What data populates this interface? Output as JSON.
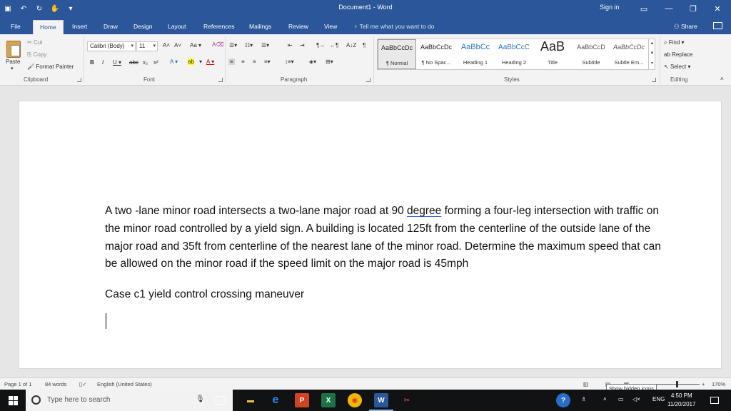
{
  "window": {
    "title": "Document1  -  Word",
    "signin": "Sign in"
  },
  "tabs": [
    "File",
    "Home",
    "Insert",
    "Draw",
    "Design",
    "Layout",
    "References",
    "Mailings",
    "Review",
    "View"
  ],
  "active_tab": "Home",
  "tellme": "Tell me what you want to do",
  "share": "Share",
  "ribbon": {
    "clipboard": {
      "label": "Clipboard",
      "paste": "Paste",
      "cut": "Cut",
      "copy": "Copy",
      "format_painter": "Format Painter"
    },
    "font": {
      "label": "Font",
      "family": "Calibri (Body)",
      "size": "11"
    },
    "paragraph": {
      "label": "Paragraph"
    },
    "styles": {
      "label": "Styles",
      "items": [
        {
          "sample": "AaBbCcDc",
          "name": "¶ Normal"
        },
        {
          "sample": "AaBbCcDc",
          "name": "¶ No Spac..."
        },
        {
          "sample": "AaBbCc",
          "name": "Heading 1"
        },
        {
          "sample": "AaBbCcC",
          "name": "Heading 2"
        },
        {
          "sample": "AaB",
          "name": "Title"
        },
        {
          "sample": "AaBbCcD",
          "name": "Subtitle"
        },
        {
          "sample": "AaBbCcDc",
          "name": "Subtle Em..."
        }
      ]
    },
    "editing": {
      "label": "Editing",
      "find": "Find",
      "replace": "Replace",
      "select": "Select"
    }
  },
  "document": {
    "paragraph1_a": "A two -lane minor road intersects a two-lane major road at 90 ",
    "paragraph1_squiggle": "degree",
    "paragraph1_b": " forming a four-leg intersection with traffic on the minor road controlled by a yield sign. A building is located 125ft from the centerline of the outside lane of the major road and 35ft from centerline of the nearest lane of the minor road. Determine the maximum speed that can be allowed on the minor road if the speed limit on the major road is 45mph",
    "paragraph2": "Case c1 yield control crossing maneuver"
  },
  "status": {
    "page": "Page 1 of 1",
    "words": "84 words",
    "language": "English (United States)",
    "zoom": "170%",
    "tooltip": "Show hidden icons"
  },
  "taskbar": {
    "search_placeholder": "Type here to search",
    "lang": "ENG",
    "time": "4:50 PM",
    "date": "11/20/2017"
  }
}
